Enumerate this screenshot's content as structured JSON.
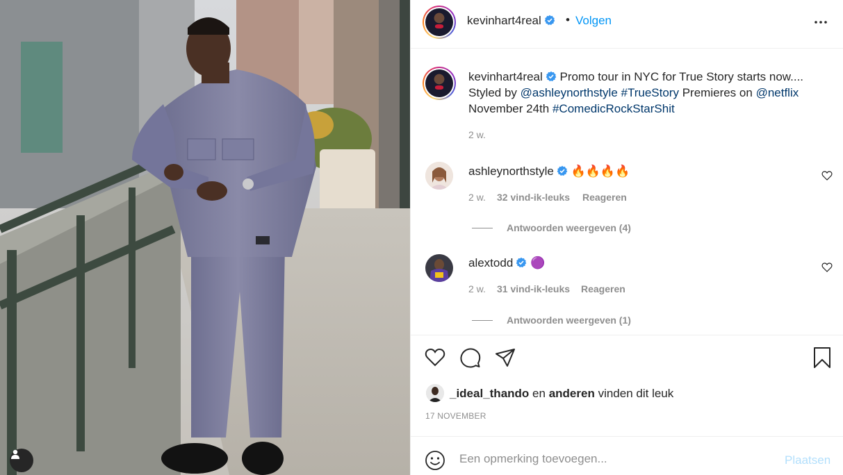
{
  "post": {
    "author": {
      "username": "kevinhart4real",
      "verified": true,
      "follow_label": "Volgen",
      "separator": "•"
    },
    "caption": {
      "username": "kevinhart4real",
      "text_1": "Promo tour in NYC for True Story starts now.... Styled by",
      "mention_1": "@ashleynorthstyle",
      "hashtag_1": "#TrueStory",
      "text_2": "Premieres on",
      "mention_2": "@netflix",
      "text_3": "November 24th",
      "hashtag_2": "#ComedicRockStarShit",
      "time": "2 w."
    },
    "comments": [
      {
        "username": "ashleynorthstyle",
        "verified": true,
        "text": "🔥🔥🔥🔥",
        "time": "2 w.",
        "likes": "32 vind-ik-leuks",
        "reply_label": "Reageren",
        "view_replies": "Antwoorden weergeven (4)"
      },
      {
        "username": "alextodd",
        "verified": true,
        "text": "🟣",
        "time": "2 w.",
        "likes": "31 vind-ik-leuks",
        "reply_label": "Reageren",
        "view_replies": "Antwoorden weergeven (1)"
      }
    ],
    "likes": {
      "first_user": "_ideal_thando",
      "connector": "en",
      "others": "anderen",
      "suffix": "vinden dit leuk"
    },
    "date": "17 NOVEMBER",
    "comment_box": {
      "placeholder": "Een opmerking toevoegen...",
      "post_label": "Plaatsen"
    }
  },
  "colors": {
    "accent": "#0095f6",
    "link": "#00376b",
    "muted": "#8e8e8e",
    "verified": "#3897f0",
    "post_disabled": "#b2dffc"
  },
  "icons": [
    "user-tag-icon",
    "more-options-icon",
    "verified-icon",
    "heart-icon",
    "comment-icon",
    "share-icon",
    "bookmark-icon",
    "emoji-icon"
  ]
}
